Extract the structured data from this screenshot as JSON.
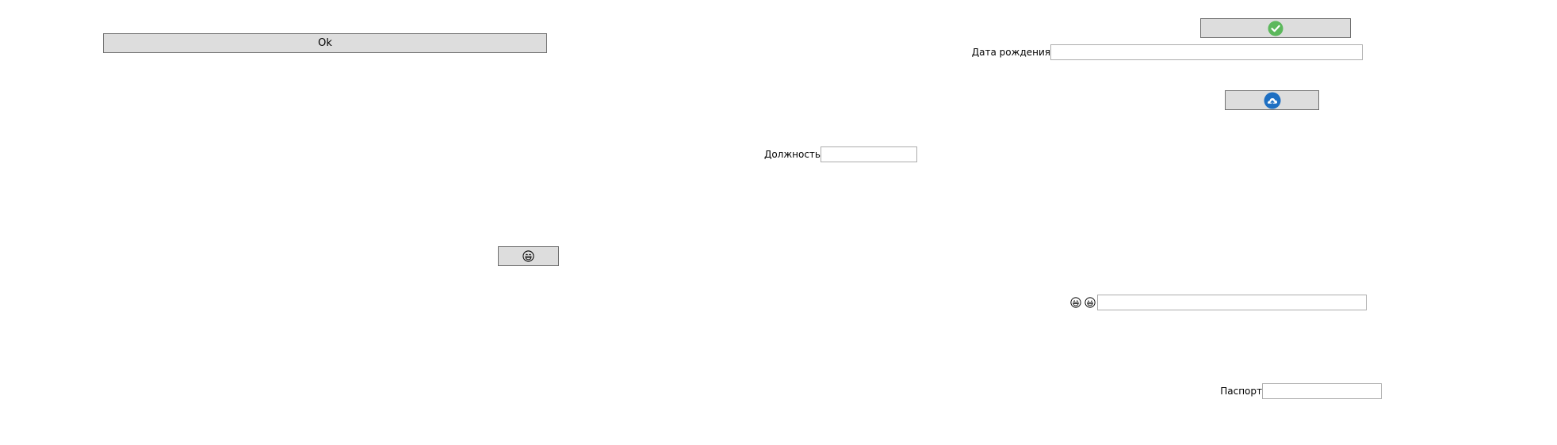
{
  "buttons": {
    "ok_label": "Ok"
  },
  "fields": {
    "birth_date": {
      "label": "Дата рождения",
      "value": ""
    },
    "position": {
      "label": "Должность",
      "value": ""
    },
    "emoji_field": {
      "value": ""
    },
    "passport": {
      "label": "Паспорт",
      "value": ""
    }
  },
  "icons": {
    "confirm": "check-circle-icon",
    "cloud": "cloud-upload-icon",
    "laughing": "laughing-face-icon",
    "grinning": "grinning-face-icon"
  },
  "colors": {
    "button_bg": "#dddddd",
    "button_border": "#707070",
    "field_border": "#acacac",
    "check_green": "#5cb85c",
    "cloud_blue": "#1e6fc2"
  }
}
